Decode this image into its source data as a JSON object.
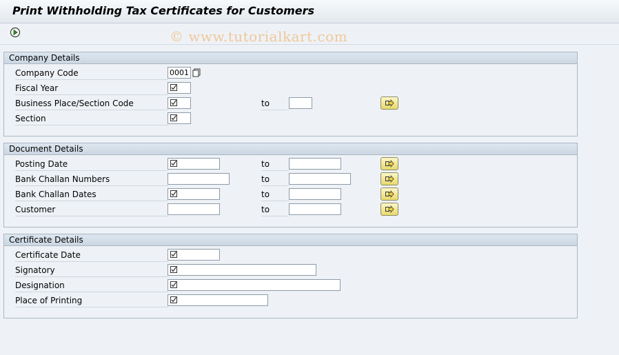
{
  "title": "Print Withholding Tax Certificates for Customers",
  "watermark": "© www.tutorialkart.com",
  "toolbar": {
    "execute_icon": "execute-icon"
  },
  "groups": [
    {
      "header": "Company Details",
      "rows": [
        {
          "label": "Company Code",
          "value": "0001"
        },
        {
          "label": "Fiscal Year"
        },
        {
          "label": "Business Place/Section Code",
          "to": "to"
        },
        {
          "label": "Section"
        }
      ]
    },
    {
      "header": "Document Details",
      "rows": [
        {
          "label": "Posting Date",
          "to": "to"
        },
        {
          "label": "Bank Challan Numbers",
          "to": "to"
        },
        {
          "label": "Bank Challan Dates",
          "to": "to"
        },
        {
          "label": "Customer",
          "to": "to"
        }
      ]
    },
    {
      "header": "Certificate Details",
      "rows": [
        {
          "label": "Certificate Date"
        },
        {
          "label": "Signatory"
        },
        {
          "label": "Designation"
        },
        {
          "label": "Place of Printing"
        }
      ]
    }
  ],
  "colors": {
    "multiple_selection_button": "#f2e68a",
    "title_bar": "#e9eef3"
  }
}
